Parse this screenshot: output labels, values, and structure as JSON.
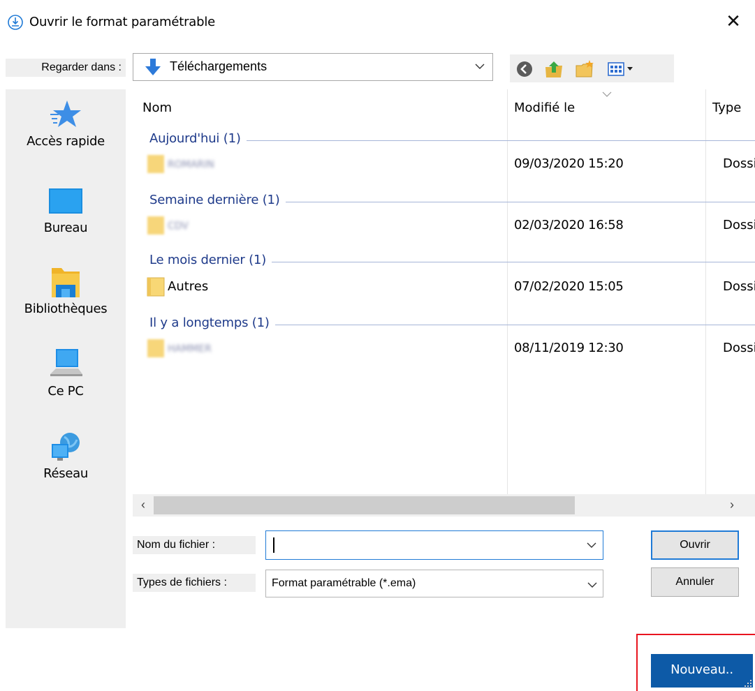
{
  "window": {
    "title": "Ouvrir le format paramétrable",
    "close_symbol": "✕",
    "title_icon": "format-icon"
  },
  "look_in": {
    "label": "Regarder dans :",
    "value": "Téléchargements",
    "icon": "download-arrow-icon"
  },
  "toolbar": {
    "buttons": [
      "back-icon",
      "up-folder-icon",
      "new-folder-icon",
      "view-menu-icon"
    ]
  },
  "places": [
    {
      "label": "Accès rapide",
      "icon": "star-icon"
    },
    {
      "label": "Bureau",
      "icon": "desktop-icon"
    },
    {
      "label": "Bibliothèques",
      "icon": "libraries-icon"
    },
    {
      "label": "Ce PC",
      "icon": "computer-icon"
    },
    {
      "label": "Réseau",
      "icon": "network-icon"
    }
  ],
  "columns": {
    "name": "Nom",
    "modified": "Modifié le",
    "type": "Type"
  },
  "groups": [
    {
      "label": "Aujourd'hui (1)",
      "files": [
        {
          "name": "ROMARIN",
          "modified": "09/03/2020 15:20",
          "type": "Dossi",
          "blurred": true
        }
      ]
    },
    {
      "label": "Semaine dernière (1)",
      "files": [
        {
          "name": "CDV",
          "modified": "02/03/2020 16:58",
          "type": "Dossi",
          "blurred": true
        }
      ]
    },
    {
      "label": "Le mois dernier (1)",
      "files": [
        {
          "name": "Autres",
          "modified": "07/02/2020 15:05",
          "type": "Dossi",
          "blurred": false
        }
      ]
    },
    {
      "label": "Il y a longtemps (1)",
      "files": [
        {
          "name": "HAMMER",
          "modified": "08/11/2019 12:30",
          "type": "Dossi",
          "blurred": true
        }
      ]
    }
  ],
  "scrollbar": {
    "left_arrow": "‹",
    "right_arrow": "›"
  },
  "filename": {
    "label": "Nom du fichier :",
    "value": ""
  },
  "filetype": {
    "label": "Types de fichiers :",
    "value": "Format paramétrable (*.ema)"
  },
  "buttons": {
    "open": "Ouvrir",
    "cancel": "Annuler",
    "new": "Nouveau.."
  },
  "colors": {
    "accent": "#1f7ad6",
    "group_text": "#1e3a8a",
    "new_button": "#0d5aa7",
    "highlight": "#e8141f"
  }
}
